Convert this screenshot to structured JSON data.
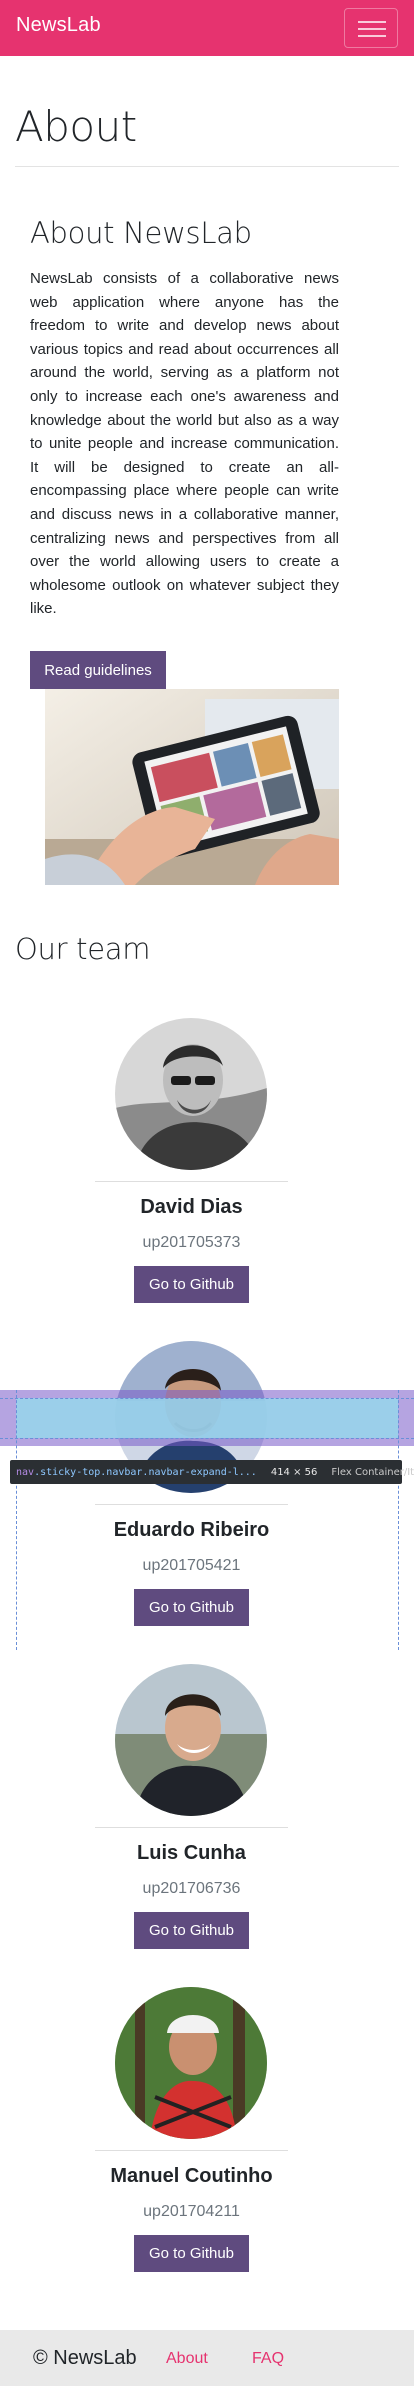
{
  "navbar": {
    "brand": "NewsLab",
    "toggler_icon": "hamburger-icon"
  },
  "page": {
    "title": "About"
  },
  "about": {
    "heading": "About NewsLab",
    "text": "NewsLab consists of a collaborative news web application where anyone has the freedom to write and develop news about various topics and read about occurrences all around the world, serving as a platform not only to increase each one's awareness and knowledge about the world but also as a way to unite people and increase communication. It will be designed to create an all-encompassing place where people can write and discuss news in a collaborative manner, centralizing news and perspectives from all over the world allowing users to create a wholesome outlook on whatever subject they like.",
    "guidelines_button": "Read guidelines"
  },
  "team": {
    "heading": "Our team",
    "members": [
      {
        "name": "David Dias",
        "id": "up201705373",
        "button": "Go to Github"
      },
      {
        "name": "Eduardo Ribeiro",
        "id": "up201705421",
        "button": "Go to Github"
      },
      {
        "name": "Luis Cunha",
        "id": "up201706736",
        "button": "Go to Github"
      },
      {
        "name": "Manuel Coutinho",
        "id": "up201704211",
        "button": "Go to Github"
      }
    ]
  },
  "devtools": {
    "tag": "nav",
    "classes": ".sticky-top.navbar.navbar-expand-l...",
    "size": "414 × 56",
    "type": "Flex Container/Item"
  },
  "footer": {
    "copyright": "© NewsLab",
    "links": [
      "About",
      "FAQ"
    ]
  },
  "colors": {
    "brand": "#e6336f",
    "button": "#5f4b7f",
    "footer_bg": "#e9e9e9"
  }
}
